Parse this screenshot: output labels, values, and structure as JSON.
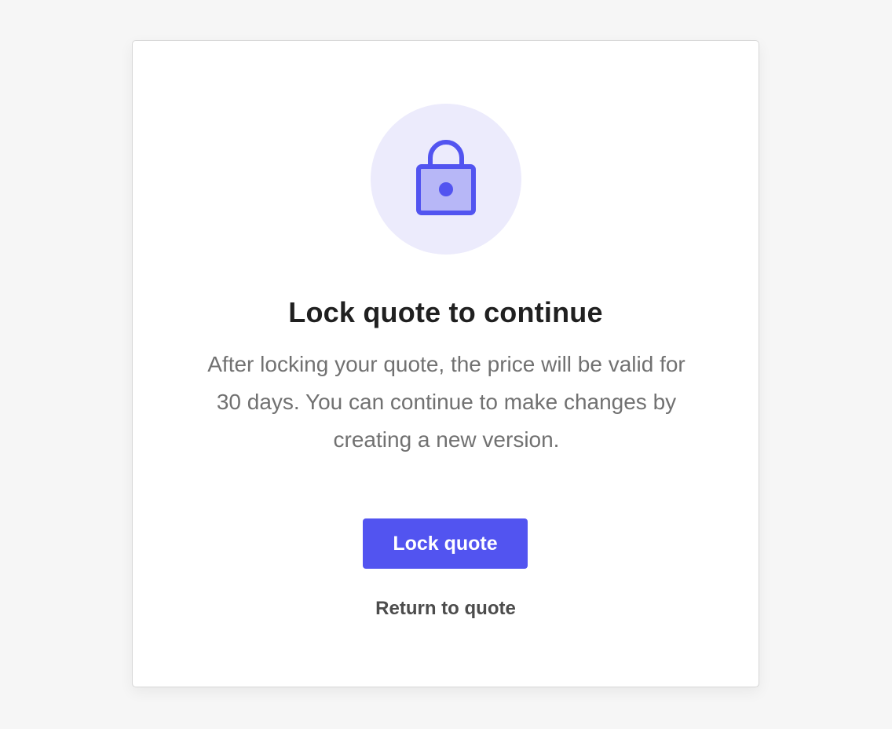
{
  "modal": {
    "icon": "lock-icon",
    "title": "Lock quote to continue",
    "description": "After locking your quote, the price will be valid for 30 days. You can continue to make changes by creating a new version.",
    "primary_button_label": "Lock quote",
    "secondary_link_label": "Return to quote"
  },
  "colors": {
    "page_background": "#f6f6f6",
    "card_background": "#ffffff",
    "accent": "#5254f0",
    "icon_circle": "#ecebfc",
    "lock_fill": "#b7b7f7",
    "title_text": "#202020",
    "body_text": "#717171",
    "link_text": "#4c4c4c"
  }
}
